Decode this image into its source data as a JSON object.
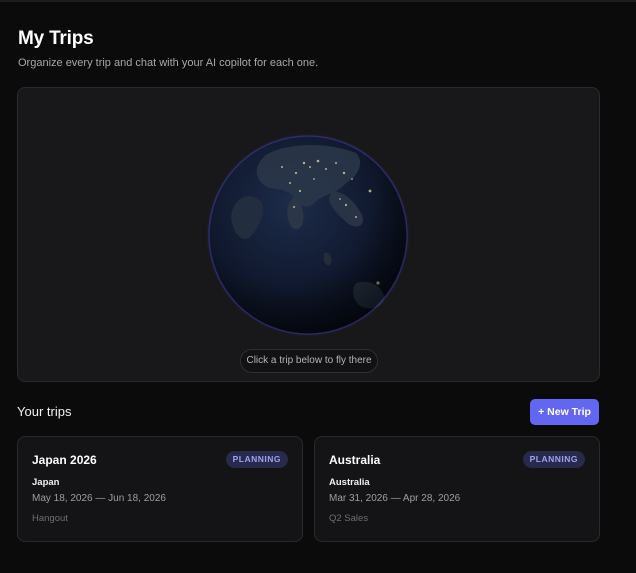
{
  "header": {
    "title": "My Trips",
    "subtitle": "Organize every trip and chat with your AI copilot for each one."
  },
  "globe": {
    "hint": "Click a trip below to fly there"
  },
  "trips_section": {
    "title": "Your trips",
    "new_trip_label": "+ New Trip"
  },
  "trips": [
    {
      "name": "Japan 2026",
      "status": "PLANNING",
      "destination": "Japan",
      "dates": "May 18, 2026 — Jun 18, 2026",
      "tag": "Hangout"
    },
    {
      "name": "Australia",
      "status": "PLANNING",
      "destination": "Australia",
      "dates": "Mar 31, 2026 — Apr 28, 2026",
      "tag": "Q2 Sales"
    }
  ],
  "colors": {
    "background": "#0b0b0c",
    "accent": "#6366f1",
    "badge_bg": "#272a4a",
    "badge_text": "#9ea2f5",
    "globe_glow": "#4b3fd6"
  }
}
